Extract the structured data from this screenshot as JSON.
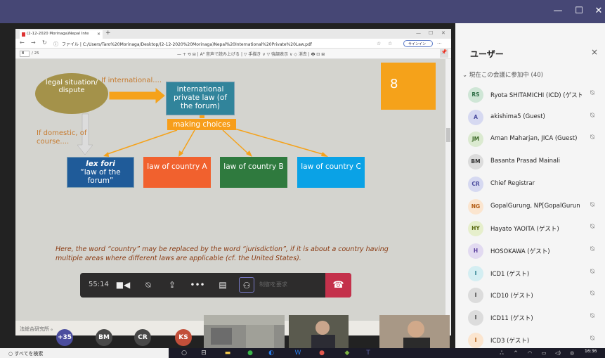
{
  "window": {
    "min": "—",
    "max": "☐",
    "close": "✕"
  },
  "browser": {
    "tab_title": "(2-12-2020 Morinaga)Nepal Inte",
    "tab_close": "×",
    "new_tab": "+",
    "url": "ファイル  |  C:/Users/Taro%20Morinaga/Desktop/(2-12-2020%20Morinaga)Nepal%20International%20Private%20Law.pdf",
    "signin": "サインイン",
    "page_current": "8",
    "page_total": "/ 25",
    "pdf_tools": "—   +   ⟲   ⊟   |  A⁸ 音声で読み上げる  |  ▽ 手描き  ∨  ▽ 強調表示  ∨  ◇ 消去  |  🖶  ⊡  ⊞"
  },
  "slide": {
    "number": "8",
    "oval": "legal situation/ dispute",
    "if_international": "If international....",
    "international_box": "international private law (of the forum)",
    "making_choices": "making choices",
    "if_domestic": "If domestic, of course....",
    "lex_fori_title": "lex fori",
    "lex_fori_sub": "“law of the forum”",
    "law_a": "law of country A",
    "law_b": "law of country B",
    "law_c": "law of country C",
    "note": "Here, the word “country” may be replaced by the word “jurisdiction”, if it is about a country having multiple areas where different laws are applicable (cf. the United States).",
    "footnote": "法総合研究所 ₑ"
  },
  "controls": {
    "timer": "55:14",
    "request_control": "制御を要求"
  },
  "participants_strip": [
    {
      "initials": "+35",
      "color": "#4b4d9e"
    },
    {
      "initials": "BM",
      "color": "#484848"
    },
    {
      "initials": "CR",
      "color": "#484848"
    },
    {
      "initials": "KS",
      "color": "#c24f3a"
    }
  ],
  "panel": {
    "title": "ユーザー",
    "close": "×",
    "section": "⌄ 現在この会議に参加中 (40)",
    "people": [
      {
        "initials": "RS",
        "name": "Ryota SHITAMICHI (ICD) (ゲスト",
        "bg": "#cfe6d6",
        "fg": "#2f6f47",
        "muted": true
      },
      {
        "initials": "A",
        "name": "akishima5 (Guest)",
        "bg": "#d6d9f1",
        "fg": "#4b4d9e",
        "muted": true
      },
      {
        "initials": "JM",
        "name": "Aman Maharjan, JICA (Guest)",
        "bg": "#dbead0",
        "fg": "#3f6b2a",
        "muted": true
      },
      {
        "initials": "BM",
        "name": "Basanta Prasad Mainali",
        "bg": "#dcdcdc",
        "fg": "#333",
        "muted": false
      },
      {
        "initials": "CR",
        "name": "Chief Registrar",
        "bg": "#d6d9f1",
        "fg": "#4b4d9e",
        "muted": false
      },
      {
        "initials": "NG",
        "name": "GopalGurung, NP[GopalGurun",
        "bg": "#fbe5cf",
        "fg": "#b35b12",
        "muted": true
      },
      {
        "initials": "HY",
        "name": "Hayato YAOITA (ゲスト)",
        "bg": "#e6efcc",
        "fg": "#5b6b14",
        "muted": true
      },
      {
        "initials": "H",
        "name": "HOSOKAWA (ゲスト)",
        "bg": "#e2daf1",
        "fg": "#5b3f9e",
        "muted": true
      },
      {
        "initials": "I",
        "name": "ICD1 (ゲスト)",
        "bg": "#d4eef2",
        "fg": "#267c8a",
        "muted": true
      },
      {
        "initials": "I",
        "name": "ICD10 (ゲスト)",
        "bg": "#dcdcdc",
        "fg": "#444",
        "muted": true
      },
      {
        "initials": "I",
        "name": "ICD11 (ゲスト)",
        "bg": "#dcdcdc",
        "fg": "#444",
        "muted": true
      },
      {
        "initials": "I",
        "name": "ICD3 (ゲスト)",
        "bg": "#fbe5cf",
        "fg": "#b35b12",
        "muted": true
      }
    ]
  },
  "taskbar": {
    "search": "すべてを検索",
    "time": "16:36"
  }
}
